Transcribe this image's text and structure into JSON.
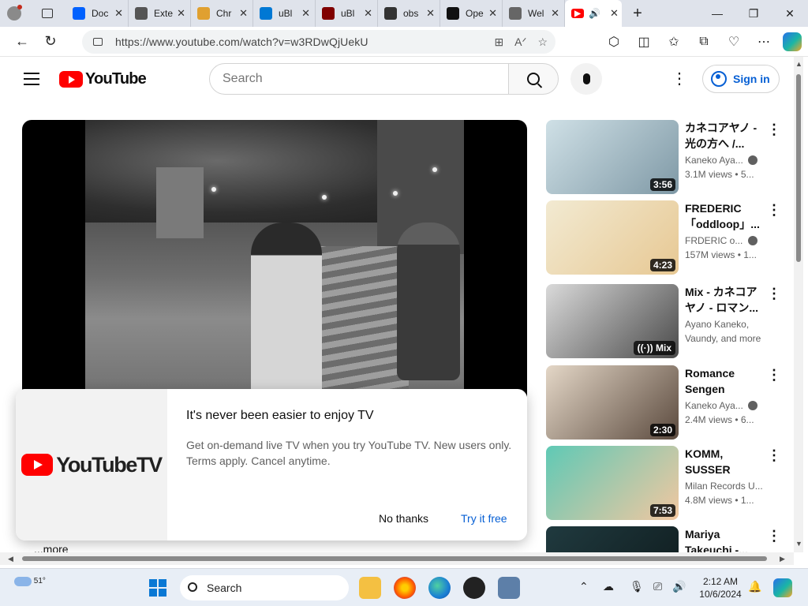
{
  "browser": {
    "tabs": [
      {
        "title": "Doc",
        "icon": "dropbox-icon",
        "color": "#0061fe"
      },
      {
        "title": "Exte",
        "icon": "extensions-icon",
        "color": "#555555"
      },
      {
        "title": "Chr",
        "icon": "chrome-rainbow-icon",
        "color": "#e0a030"
      },
      {
        "title": "uBl",
        "icon": "microsoft-store-icon",
        "color": "#0078d4"
      },
      {
        "title": "uBl",
        "icon": "ublock-icon",
        "color": "#800000"
      },
      {
        "title": "obs",
        "icon": "search-icon",
        "color": "#333333"
      },
      {
        "title": "Ope",
        "icon": "openai-icon",
        "color": "#111111"
      },
      {
        "title": "Wel",
        "icon": "page-icon",
        "color": "#666666"
      }
    ],
    "active_tab": {
      "icon": "youtube-icon",
      "color": "#ff0000"
    },
    "url": "https://www.youtube.com/watch?v=w3RDwQjUekU"
  },
  "youtube": {
    "logo_text": "YouTube",
    "search_placeholder": "Search",
    "sign_in": "Sign in",
    "promo": {
      "logo_text": "YouTubeTV",
      "title": "It's never been easier to enjoy TV",
      "description": "Get on-demand live TV when you try YouTube TV. New users only. Terms apply. Cancel anytime.",
      "dismiss": "No thanks",
      "accept": "Try it free"
    },
    "more_label": "...more",
    "recommendations": [
      {
        "title": "カネコアヤノ - 光の方へ /...",
        "channel": "Kaneko Aya...",
        "meta": "3.1M views • 5...",
        "duration": "3:56",
        "verified": true,
        "thumb": [
          "#cfe0e6",
          "#7f99a6"
        ]
      },
      {
        "title": "FREDERIC 「oddloop」...",
        "channel": "FRDERIC o...",
        "meta": "157M views • 1...",
        "duration": "4:23",
        "verified": true,
        "thumb": [
          "#f2ead2",
          "#e7c893"
        ]
      },
      {
        "title": "Mix - カネコアヤノ - ロマン...",
        "channel": "Ayano Kaneko,",
        "meta": "Vaundy, and more",
        "badge": "Mix",
        "verified": false,
        "thumb": [
          "#dadada",
          "#4a4a4a"
        ]
      },
      {
        "title": "Romance Sengen",
        "channel": "Kaneko Aya...",
        "meta": "2.4M views • 6...",
        "duration": "2:30",
        "verified": true,
        "thumb": [
          "#e4d7c7",
          "#5b4a3e"
        ]
      },
      {
        "title": "KOMM, SUSSER TOD...",
        "channel": "Milan Records U...",
        "meta": "4.8M views • 1...",
        "duration": "7:53",
        "verified": false,
        "thumb": [
          "#5fc9b5",
          "#f2c7a0"
        ]
      },
      {
        "title": "Mariya Takeuchi -...",
        "channel": "",
        "meta": "",
        "verified": false,
        "thumb": [
          "#203a3f",
          "#0e1a1c"
        ]
      }
    ]
  },
  "taskbar": {
    "weather": "51°",
    "search_label": "Search",
    "time": "2:12 AM",
    "date": "10/6/2024"
  }
}
